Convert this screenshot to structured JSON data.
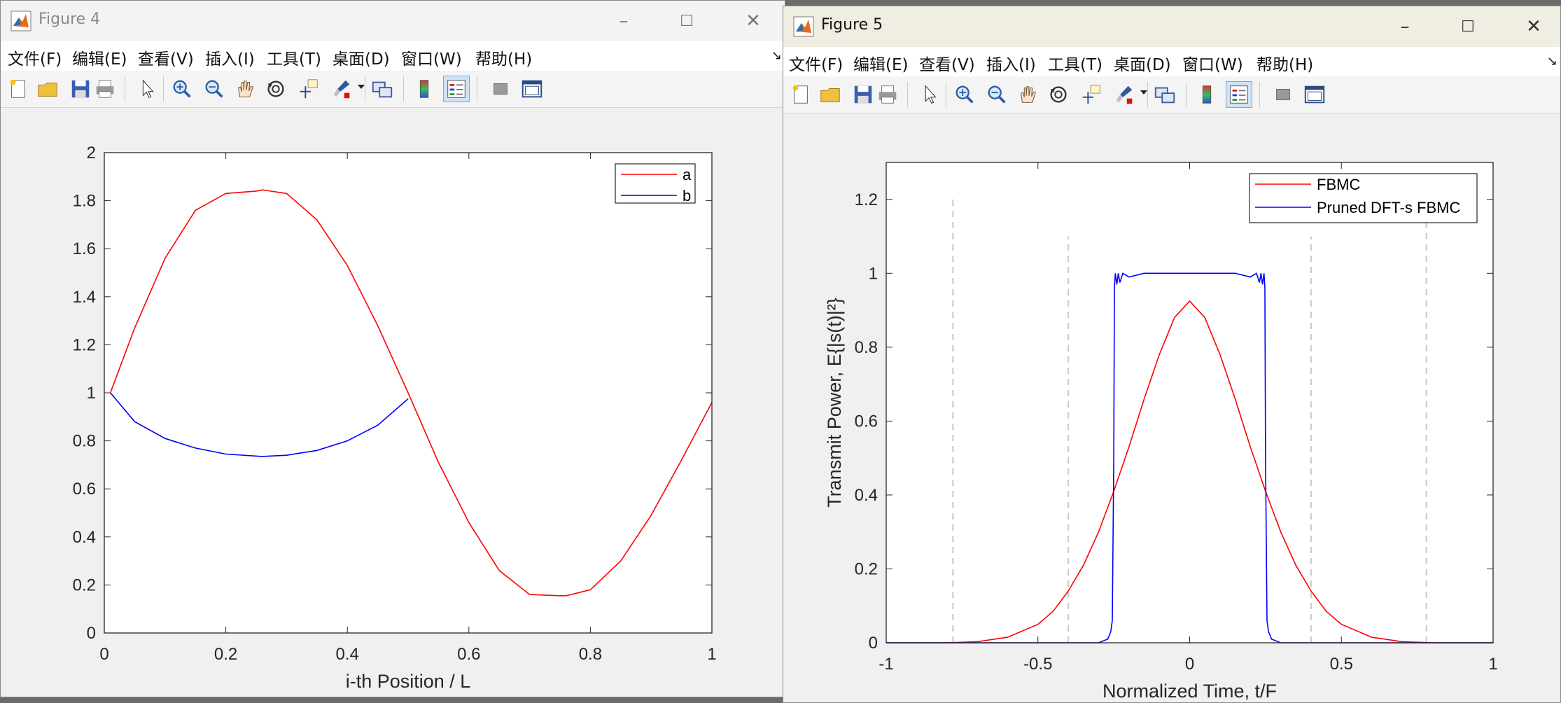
{
  "windows": [
    {
      "title": "Figure 4",
      "menu": [
        "文件(F)",
        "编辑(E)",
        "查看(V)",
        "插入(I)",
        "工具(T)",
        "桌面(D)",
        "窗口(W)",
        "帮助(H)"
      ],
      "controls": {
        "minimize": "–",
        "maximize": "☐",
        "close": "✕"
      }
    },
    {
      "title": "Figure 5",
      "menu": [
        "文件(F)",
        "编辑(E)",
        "查看(V)",
        "插入(I)",
        "工具(T)",
        "桌面(D)",
        "窗口(W)",
        "帮助(H)"
      ],
      "controls": {
        "minimize": "–",
        "maximize": "☐",
        "close": "✕"
      }
    }
  ],
  "toolbar_icons": [
    "new-figure-icon",
    "open-file-icon",
    "save-icon",
    "print-icon",
    "pointer-icon",
    "zoom-in-icon",
    "zoom-out-icon",
    "pan-icon",
    "rotate-3d-icon",
    "data-cursor-icon",
    "brush-icon",
    "link-plot-icon",
    "colorbar-icon",
    "legend-icon",
    "hide-plot-tools-icon",
    "show-plot-tools-icon"
  ],
  "chart_data": [
    {
      "type": "line",
      "title": "",
      "xlabel": "i-th Position / L",
      "ylabel": "",
      "xlim": [
        0,
        1
      ],
      "ylim": [
        0,
        2
      ],
      "xticks": [
        "0",
        "0.2",
        "0.4",
        "0.6",
        "0.8",
        "1"
      ],
      "yticks": [
        "0",
        "0.2",
        "0.4",
        "0.6",
        "0.8",
        "1",
        "1.2",
        "1.4",
        "1.6",
        "1.8",
        "2"
      ],
      "legend_position": "top-right",
      "grid": false,
      "series": [
        {
          "name": "a",
          "color": "#ff0000",
          "x": [
            0.01,
            0.05,
            0.1,
            0.15,
            0.2,
            0.25,
            0.26,
            0.3,
            0.35,
            0.4,
            0.45,
            0.5,
            0.55,
            0.6,
            0.65,
            0.7,
            0.75,
            0.76,
            0.8,
            0.85,
            0.9,
            0.95,
            1.0
          ],
          "y": [
            1.0,
            1.27,
            1.56,
            1.76,
            1.83,
            1.84,
            1.845,
            1.83,
            1.72,
            1.53,
            1.28,
            1.0,
            0.71,
            0.46,
            0.26,
            0.16,
            0.155,
            0.155,
            0.18,
            0.3,
            0.49,
            0.72,
            0.96
          ]
        },
        {
          "name": "b",
          "color": "#0000ff",
          "x": [
            0.01,
            0.05,
            0.1,
            0.15,
            0.2,
            0.26,
            0.3,
            0.35,
            0.4,
            0.45,
            0.5
          ],
          "y": [
            1.0,
            0.88,
            0.81,
            0.77,
            0.745,
            0.735,
            0.74,
            0.76,
            0.8,
            0.865,
            0.975
          ]
        }
      ]
    },
    {
      "type": "line",
      "title": "",
      "xlabel": "Normalized Time, t/F",
      "ylabel": "Transmit Power, E{|s(t)|²}",
      "xlim": [
        -1,
        1
      ],
      "ylim": [
        0,
        1.3
      ],
      "xticks": [
        "-1",
        "-0.5",
        "0",
        "0.5",
        "1"
      ],
      "yticks": [
        "0",
        "0.2",
        "0.4",
        "0.6",
        "0.8",
        "1",
        "1.2"
      ],
      "legend_position": "top-right",
      "grid": false,
      "vertical_dashed_lines": [
        {
          "x": -0.78,
          "y_top": 1.2
        },
        {
          "x": -0.4,
          "y_top": 1.1
        },
        {
          "x": 0.4,
          "y_top": 1.1
        },
        {
          "x": 0.78,
          "y_top": 1.2
        }
      ],
      "series": [
        {
          "name": "FBMC",
          "color": "#ff0000",
          "x": [
            -1.0,
            -0.8,
            -0.7,
            -0.6,
            -0.5,
            -0.45,
            -0.4,
            -0.35,
            -0.3,
            -0.25,
            -0.2,
            -0.15,
            -0.1,
            -0.05,
            0.0,
            0.05,
            0.1,
            0.15,
            0.2,
            0.25,
            0.3,
            0.35,
            0.4,
            0.45,
            0.5,
            0.6,
            0.7,
            0.8,
            1.0
          ],
          "y": [
            0.0,
            0.0,
            0.003,
            0.015,
            0.05,
            0.085,
            0.14,
            0.21,
            0.3,
            0.41,
            0.53,
            0.66,
            0.78,
            0.88,
            0.925,
            0.88,
            0.78,
            0.66,
            0.53,
            0.41,
            0.3,
            0.21,
            0.14,
            0.085,
            0.05,
            0.015,
            0.003,
            0.0,
            0.0
          ]
        },
        {
          "name": "Pruned DFT-s FBMC",
          "color": "#0000ff",
          "x": [
            -1.0,
            -0.3,
            -0.27,
            -0.26,
            -0.255,
            -0.25,
            -0.248,
            -0.245,
            -0.24,
            -0.235,
            -0.23,
            -0.22,
            -0.2,
            -0.15,
            -0.1,
            0.0,
            0.1,
            0.15,
            0.2,
            0.22,
            0.23,
            0.235,
            0.24,
            0.245,
            0.248,
            0.25,
            0.255,
            0.26,
            0.27,
            0.3,
            1.0
          ],
          "y": [
            0.0,
            0.0,
            0.01,
            0.03,
            0.06,
            0.5,
            0.96,
            1.0,
            0.97,
            1.0,
            0.975,
            1.0,
            0.99,
            1.0,
            1.0,
            1.0,
            1.0,
            1.0,
            0.99,
            1.0,
            0.975,
            1.0,
            0.97,
            1.0,
            0.96,
            0.5,
            0.06,
            0.03,
            0.01,
            0.0,
            0.0
          ]
        }
      ]
    }
  ]
}
